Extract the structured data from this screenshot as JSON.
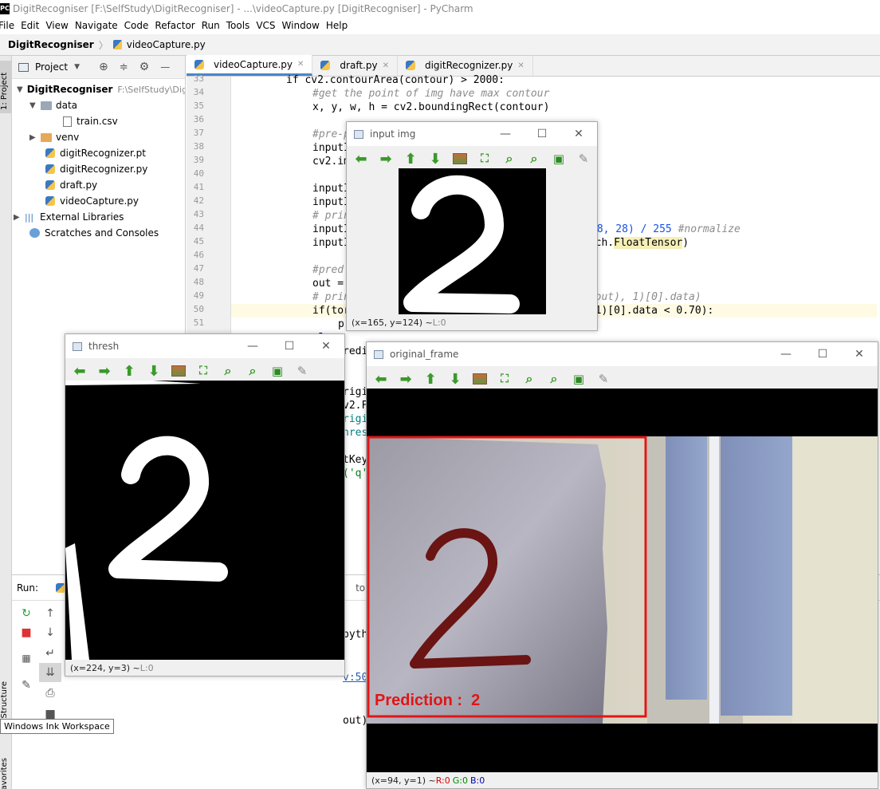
{
  "window": {
    "app_icon": "PC",
    "title": "DigitRecogniser [F:\\SelfStudy\\DigitRecogniser] - ...\\videoCapture.py [DigitRecogniser] - PyCharm"
  },
  "menu": [
    "File",
    "Edit",
    "View",
    "Navigate",
    "Code",
    "Refactor",
    "Run",
    "Tools",
    "VCS",
    "Window",
    "Help"
  ],
  "nav": {
    "project": "DigitRecogniser",
    "separator": "〉",
    "file": "videoCapture.py"
  },
  "side_tabs": {
    "project": "1: Project",
    "structure": "Structure",
    "favorites": "avorites"
  },
  "project_panel": {
    "header": "Project",
    "root": {
      "name": "DigitRecogniser",
      "path": "F:\\SelfStudy\\Dig"
    },
    "items": [
      {
        "name": "data",
        "kind": "folder"
      },
      {
        "name": "train.csv",
        "kind": "file"
      },
      {
        "name": "venv",
        "kind": "folder"
      },
      {
        "name": "digitRecognizer.pt",
        "kind": "file"
      },
      {
        "name": "digitRecognizer.py",
        "kind": "py"
      },
      {
        "name": "draft.py",
        "kind": "py"
      },
      {
        "name": "videoCapture.py",
        "kind": "py"
      },
      {
        "name": "External Libraries",
        "kind": "lib"
      },
      {
        "name": "Scratches and Consoles",
        "kind": "scratch"
      }
    ]
  },
  "tabs": [
    {
      "label": "videoCapture.py",
      "active": true
    },
    {
      "label": "draft.py",
      "active": false
    },
    {
      "label": "digitRecognizer.py",
      "active": false
    }
  ],
  "code": {
    "line_numbers": [
      "33",
      "34",
      "35",
      "36",
      "37",
      "38",
      "39",
      "40",
      "41",
      "42",
      "43",
      "44",
      "45",
      "46",
      "47",
      "48",
      "49",
      "50",
      "51"
    ],
    "line_33": "if cv2.contourArea(contour) > 2000:",
    "line_34": "#get the point of img have max contour",
    "line_35": "x, y, w, h = cv2.boundingRect(contour)",
    "line_37": "#pre-p",
    "line_38": "inputI",
    "line_39": "cv2.im",
    "line_41": "inputI",
    "line_42": "inputI",
    "line_43": "# prin",
    "line_44a": "inputI",
    "line_44b": "28, 28) / 255 ",
    "line_44c": "#normalize",
    "line_45a": "inputI",
    "line_45b": "orch.",
    "line_45c": "FloatTensor",
    "line_45d": ")",
    "line_47": "#pred",
    "line_48": "out = ",
    "line_49a": "# prin",
    "line_49b": "x(out), 1)[0].data)",
    "line_50a": "if(tor",
    "line_50b": ", 1)[0].data < 0.70):",
    "line_51": "p",
    "frag_a": "els",
    "frag_b": "redi",
    "frag_c": "rigi",
    "frag_d": "v2.F",
    "frag_e": "rigi",
    "frag_f": "hres",
    "frag_g": "tKey",
    "frag_h": "('q'",
    "frag_i": "tours",
    "frag_j": "pyth",
    "frag_k": "v:50",
    "frag_l": "out)"
  },
  "run_panel": {
    "label": "Run:"
  },
  "tooltip": "Windows Ink Workspace",
  "cv_windows": {
    "input": {
      "title": "input img",
      "status": "(x=165, y=124) ~ ",
      "status_dim": "L:0"
    },
    "thresh": {
      "title": "thresh",
      "status": "(x=224, y=3) ~ ",
      "status_dim": "L:0"
    },
    "original": {
      "title": "original_frame",
      "status": "(x=94, y=1) ~ ",
      "r": "R:0",
      "g": "G:0",
      "b": "B:0",
      "prediction": "Prediction :  2",
      "digit": "2"
    },
    "toolbar_icons": [
      "arrow-left-icon",
      "arrow-right-icon",
      "arrow-up-icon",
      "arrow-down-icon",
      "image-icon",
      "zoom-fit-icon",
      "zoom-in-icon",
      "zoom-out-icon",
      "save-icon",
      "brush-icon"
    ]
  },
  "colors": {
    "accent": "#4a86c8",
    "toolbar_green": "#3a9a2a",
    "prediction_red": "#e01616",
    "line_highlight": "#fffae3"
  }
}
